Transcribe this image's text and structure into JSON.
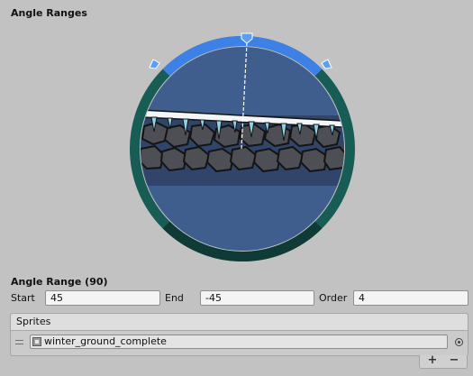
{
  "header": {
    "title": "Angle Ranges"
  },
  "colors": {
    "selected_arc": "#3d80e6",
    "unselected_arc": "#185d55",
    "disc_fill": "#3f5e8e",
    "background": "#c2c2c2"
  },
  "range": {
    "title": "Angle Range (90)",
    "start_label": "Start",
    "start_value": "45",
    "end_label": "End",
    "end_value": "-45",
    "order_label": "Order",
    "order_value": "4"
  },
  "sprites": {
    "header": "Sprites",
    "items": [
      {
        "name": "winter_ground_complete",
        "icon": "sprite-icon"
      }
    ],
    "add_label": "+",
    "remove_label": "−"
  }
}
